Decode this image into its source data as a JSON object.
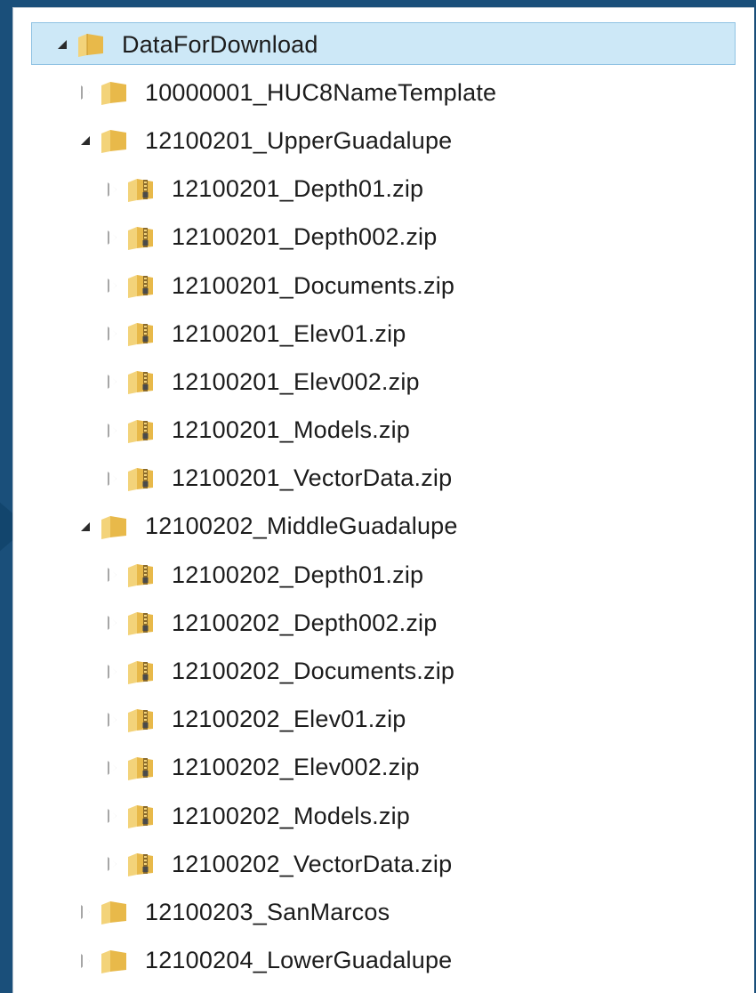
{
  "tree": {
    "root": {
      "label": "DataForDownload",
      "icon": "folder-icon",
      "expanded": true,
      "selected": true
    },
    "items": [
      {
        "label": "10000001_HUC8NameTemplate",
        "icon": "folder-icon",
        "expanded": false
      },
      {
        "label": "12100201_UpperGuadalupe",
        "icon": "folder-icon",
        "expanded": true,
        "children": [
          {
            "label": "12100201_Depth01.zip",
            "icon": "zip-folder-icon"
          },
          {
            "label": "12100201_Depth002.zip",
            "icon": "zip-folder-icon"
          },
          {
            "label": "12100201_Documents.zip",
            "icon": "zip-folder-icon"
          },
          {
            "label": "12100201_Elev01.zip",
            "icon": "zip-folder-icon"
          },
          {
            "label": "12100201_Elev002.zip",
            "icon": "zip-folder-icon"
          },
          {
            "label": "12100201_Models.zip",
            "icon": "zip-folder-icon"
          },
          {
            "label": "12100201_VectorData.zip",
            "icon": "zip-folder-icon"
          }
        ]
      },
      {
        "label": "12100202_MiddleGuadalupe",
        "icon": "folder-icon",
        "expanded": true,
        "children": [
          {
            "label": "12100202_Depth01.zip",
            "icon": "zip-folder-icon"
          },
          {
            "label": "12100202_Depth002.zip",
            "icon": "zip-folder-icon"
          },
          {
            "label": "12100202_Documents.zip",
            "icon": "zip-folder-icon"
          },
          {
            "label": "12100202_Elev01.zip",
            "icon": "zip-folder-icon"
          },
          {
            "label": "12100202_Elev002.zip",
            "icon": "zip-folder-icon"
          },
          {
            "label": "12100202_Models.zip",
            "icon": "zip-folder-icon"
          },
          {
            "label": "12100202_VectorData.zip",
            "icon": "zip-folder-icon"
          }
        ]
      },
      {
        "label": "12100203_SanMarcos",
        "icon": "folder-icon",
        "expanded": false
      },
      {
        "label": "12100204_LowerGuadalupe",
        "icon": "folder-icon",
        "expanded": false
      }
    ]
  },
  "colors": {
    "frame": "#1a4f7a",
    "selection": "#cde8f7",
    "selection_border": "#8fc2e3",
    "folder": "#e8b94a",
    "text": "#1c1c1c"
  }
}
